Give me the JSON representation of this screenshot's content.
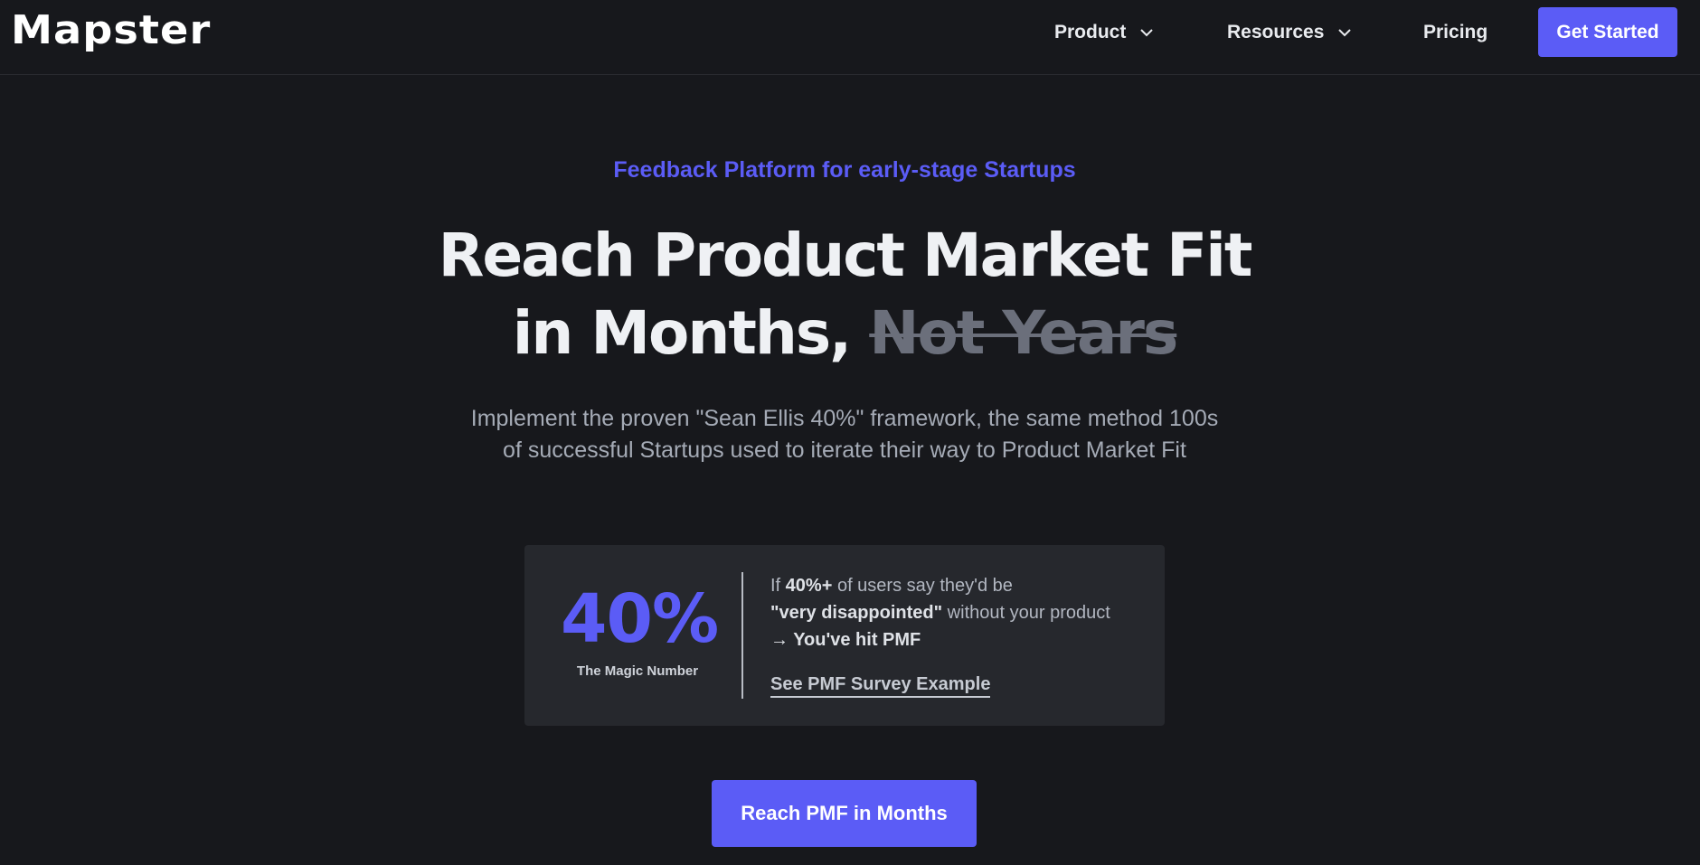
{
  "header": {
    "logo": "Mapster",
    "nav": [
      {
        "label": "Product"
      },
      {
        "label": "Resources"
      },
      {
        "label": "Pricing"
      }
    ],
    "cta_label": "Get Started"
  },
  "hero": {
    "eyebrow": "Feedback Platform for early-stage Startups",
    "headline_line1": "Reach Product Market Fit",
    "headline_line2": "in Months,",
    "headline_strike": "Not Years",
    "subtext": "Implement the proven \"Sean Ellis 40%\" framework, the same method 100s of successful Startups used to iterate their way to Product Market Fit"
  },
  "pmf_card": {
    "number": "40%",
    "caption": "The Magic Number",
    "line1_prefix": "If ",
    "line1_bold": "40%+",
    "line1_suffix": " of users say they'd be",
    "line2_bold": "\"very disappointed\"",
    "line2_suffix": " without your product",
    "line3": "→ You've hit PMF",
    "link_label": "See PMF Survey Example"
  },
  "cta_main_label": "Reach PMF in Months",
  "colors": {
    "accent": "#5b5cf6",
    "background": "#17181c",
    "card": "#26282d"
  }
}
